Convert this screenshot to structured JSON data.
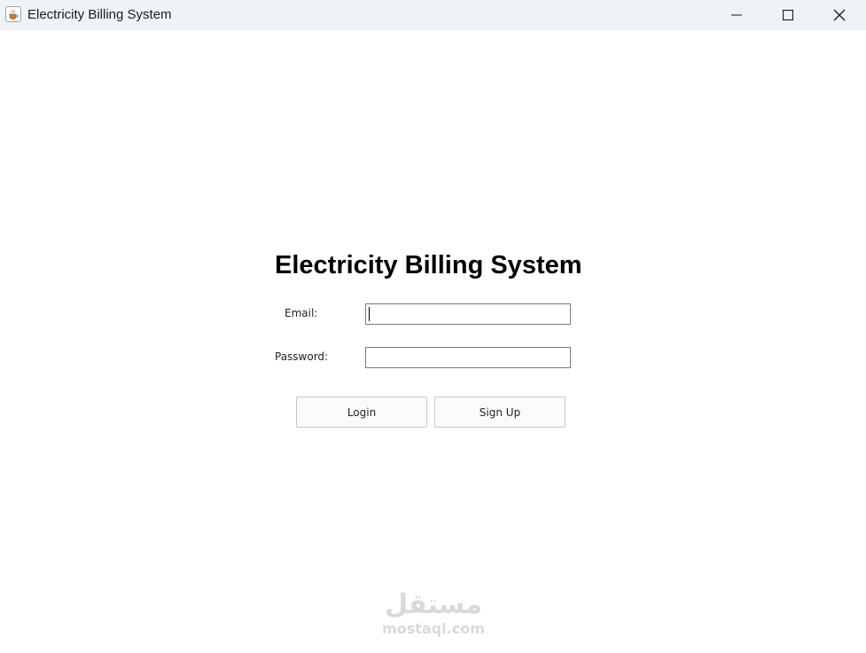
{
  "window": {
    "title": "Electricity Billing System",
    "icon": "java-coffee-cup-icon",
    "controls": [
      "minimize-icon",
      "maximize-icon",
      "close-icon"
    ]
  },
  "form": {
    "heading": "Electricity Billing System",
    "email_label": "Email:",
    "email_value": "",
    "password_label": "Password:",
    "password_value": "",
    "login_label": "Login",
    "signup_label": "Sign Up"
  },
  "watermark": {
    "logo_text": "مستقل",
    "url_text": "mostaql.com"
  }
}
